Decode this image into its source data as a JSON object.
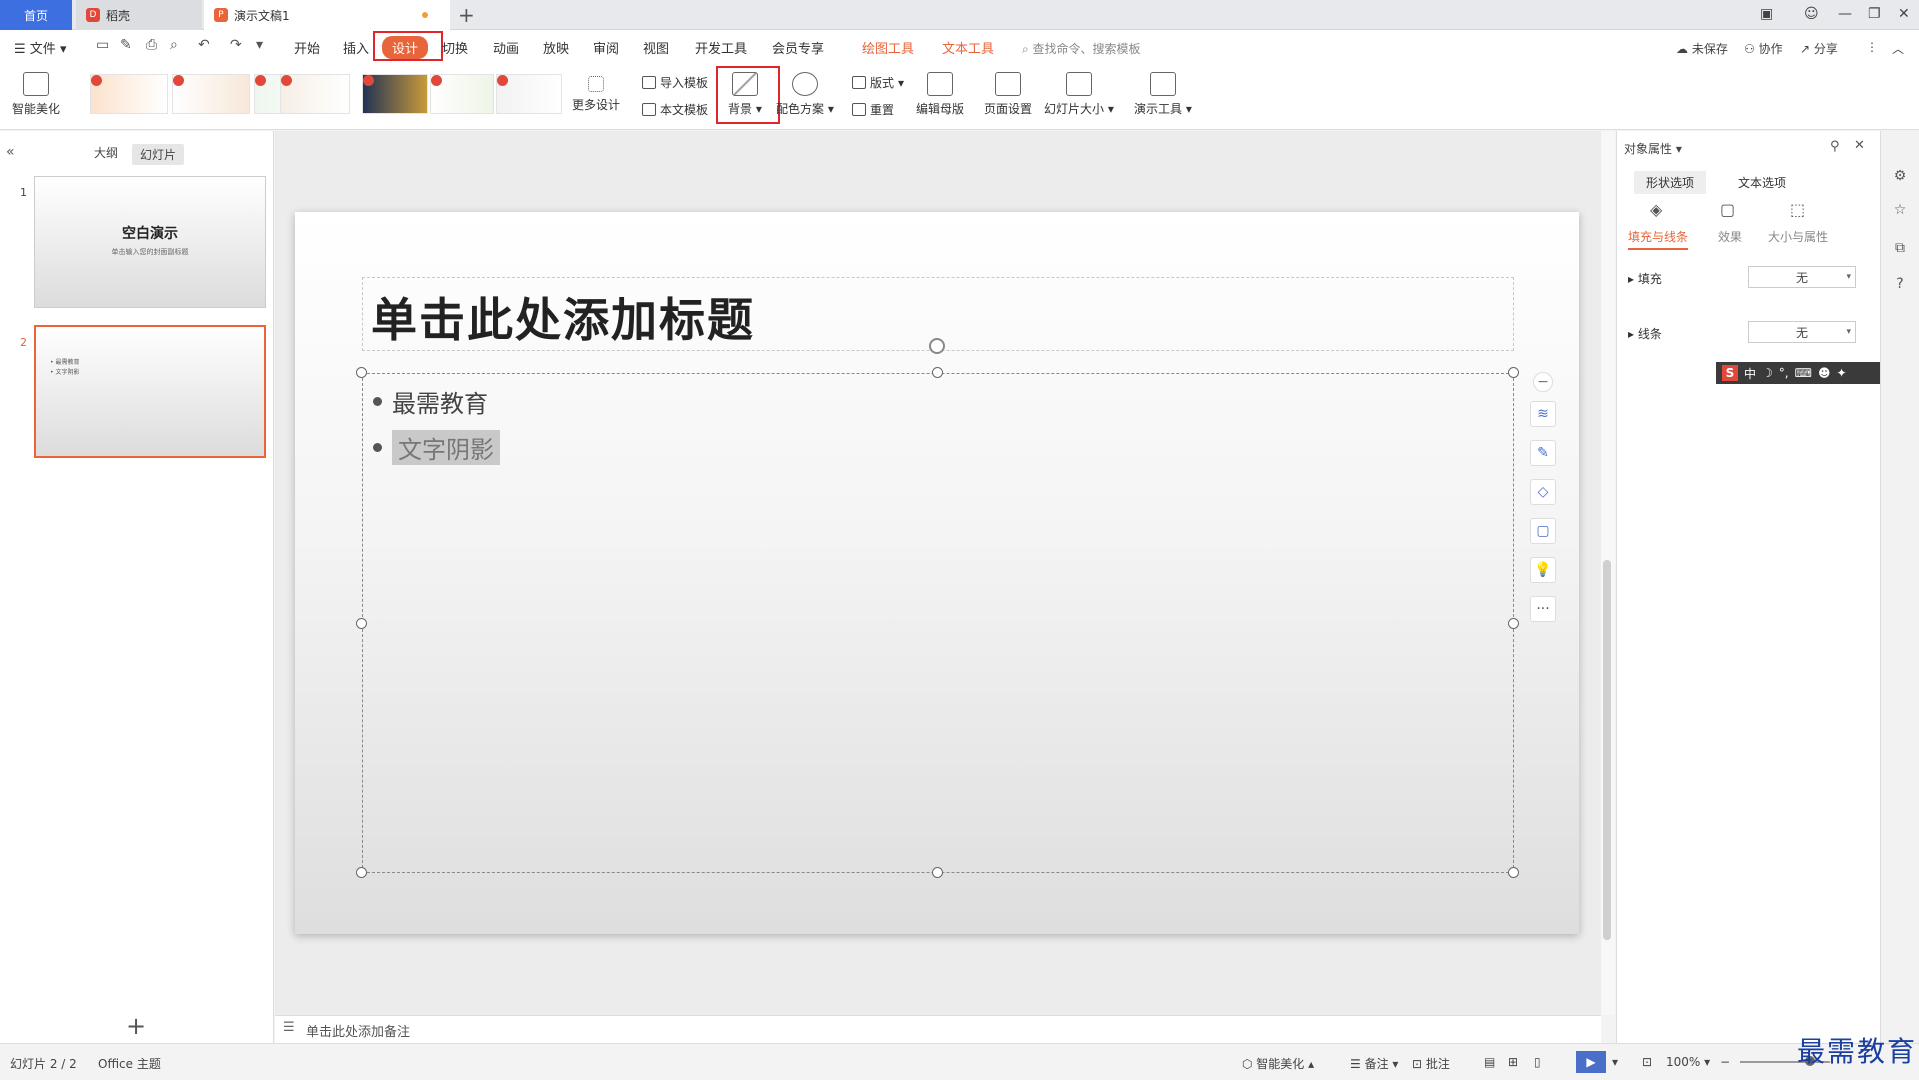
{
  "tabs": {
    "home": "首页",
    "daoke": "稻壳",
    "doc": "演示文稿1"
  },
  "menu": {
    "file": "文件",
    "items": [
      "开始",
      "插入",
      "设计",
      "切换",
      "动画",
      "放映",
      "审阅",
      "视图",
      "开发工具",
      "会员专享"
    ],
    "drawing_tools": "绘图工具",
    "text_tools": "文本工具",
    "search": "查找命令、搜索模板",
    "unsaved": "未保存",
    "collab": "协作",
    "share": "分享"
  },
  "ribbon": {
    "smart": "智能美化",
    "more_design": "更多设计",
    "import_tpl": "导入模板",
    "this_tpl": "本文模板",
    "background": "背景",
    "color_scheme": "配色方案",
    "layout": "版式",
    "reset": "重置",
    "edit_master": "编辑母版",
    "page_setup": "页面设置",
    "slide_size": "幻灯片大小",
    "present_tools": "演示工具"
  },
  "left_panel": {
    "outline": "大纲",
    "slides": "幻灯片",
    "thumb1_title": "空白演示",
    "thumb1_sub": "单击输入您的封面副标题",
    "thumb2_b1": "最需教育",
    "thumb2_b2": "文字阴影",
    "num1": "1",
    "num2": "2"
  },
  "slide": {
    "title": "单击此处添加标题",
    "bullet1": "最需教育",
    "bullet2": "文字阴影"
  },
  "notes": "单击此处添加备注",
  "props": {
    "header": "对象属性",
    "tab_shape": "形状选项",
    "tab_text": "文本选项",
    "sub_fill": "填充与线条",
    "sub_effect": "效果",
    "sub_size": "大小与属性",
    "fill": "填充",
    "fill_val": "无",
    "line": "线条",
    "line_val": "无"
  },
  "ime": {
    "s": "S",
    "lang": "中"
  },
  "status": {
    "slide_count": "幻灯片 2 / 2",
    "theme": "Office 主题",
    "smart": "智能美化",
    "notes": "备注",
    "comment": "批注",
    "zoom": "100%"
  },
  "watermark": "最需教育"
}
